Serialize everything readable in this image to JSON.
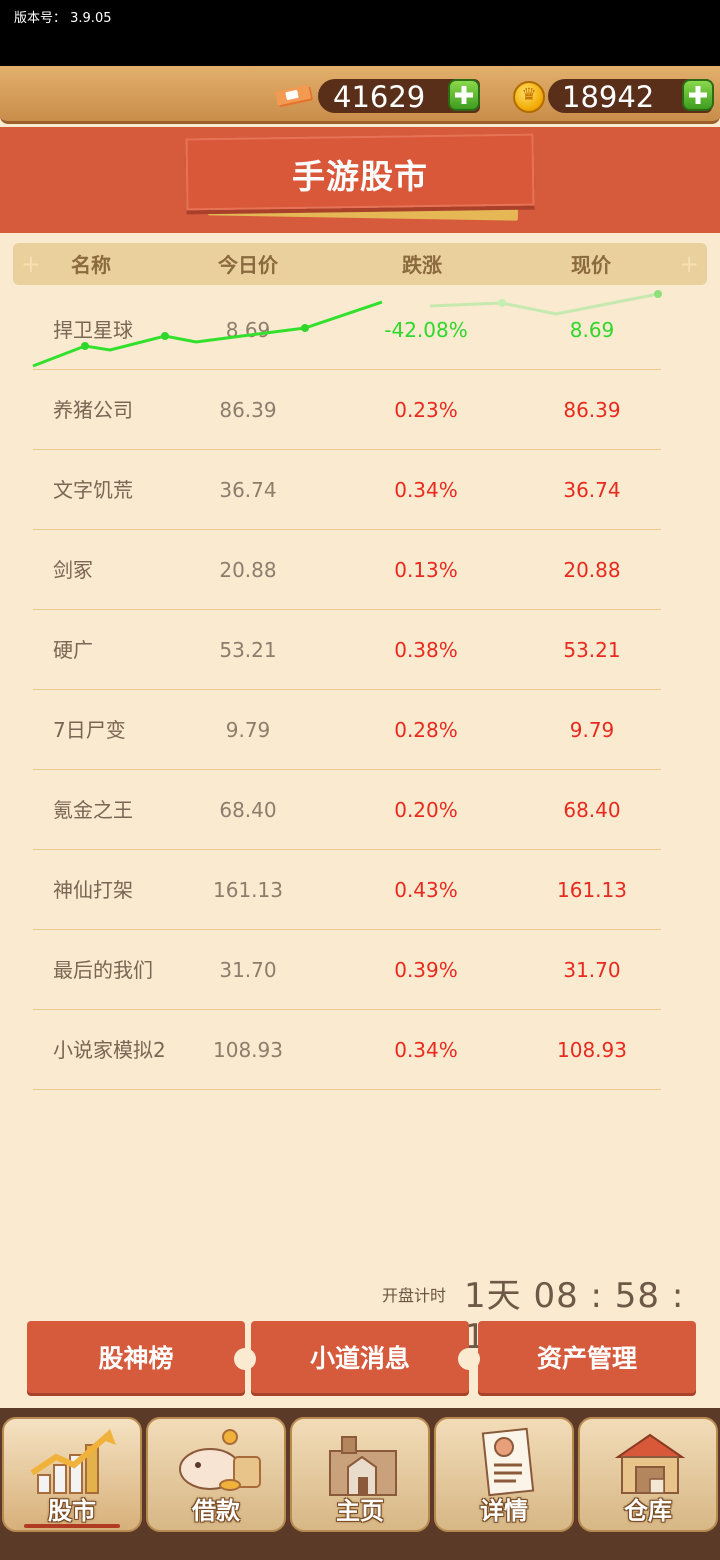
{
  "app": {
    "version_label": "版本号：  3.9.05"
  },
  "currency": {
    "cash": "41629",
    "coins": "18942"
  },
  "header": {
    "title": "手游股市"
  },
  "table": {
    "columns": [
      "名称",
      "今日价",
      "跌涨",
      "现价"
    ],
    "rows": [
      {
        "name": "捍卫星球",
        "today": "8.69",
        "change": "-42.08%",
        "current": "8.69",
        "trend": "down"
      },
      {
        "name": "养猪公司",
        "today": "86.39",
        "change": "0.23%",
        "current": "86.39",
        "trend": "up"
      },
      {
        "name": "文字饥荒",
        "today": "36.74",
        "change": "0.34%",
        "current": "36.74",
        "trend": "up"
      },
      {
        "name": "剑冢",
        "today": "20.88",
        "change": "0.13%",
        "current": "20.88",
        "trend": "up"
      },
      {
        "name": "硬广",
        "today": "53.21",
        "change": "0.38%",
        "current": "53.21",
        "trend": "up"
      },
      {
        "name": "7日尸变",
        "today": "9.79",
        "change": "0.28%",
        "current": "9.79",
        "trend": "up"
      },
      {
        "name": "氪金之王",
        "today": "68.40",
        "change": "0.20%",
        "current": "68.40",
        "trend": "up"
      },
      {
        "name": "神仙打架",
        "today": "161.13",
        "change": "0.43%",
        "current": "161.13",
        "trend": "up"
      },
      {
        "name": "最后的我们",
        "today": "31.70",
        "change": "0.39%",
        "current": "31.70",
        "trend": "up"
      },
      {
        "name": "小说家模拟2",
        "today": "108.93",
        "change": "0.34%",
        "current": "108.93",
        "trend": "up"
      }
    ]
  },
  "countdown": {
    "label": "开盘计时",
    "value": "1天 08 : 58 : 11"
  },
  "actions": {
    "leaderboard": "股神榜",
    "news": "小道消息",
    "assets": "资产管理"
  },
  "nav": {
    "tabs": [
      {
        "label": "股市",
        "icon": "stock-chart-icon",
        "active": true
      },
      {
        "label": "借款",
        "icon": "piggy-bank-icon",
        "active": false
      },
      {
        "label": "主页",
        "icon": "home-building-icon",
        "active": false
      },
      {
        "label": "详情",
        "icon": "profile-card-icon",
        "active": false
      },
      {
        "label": "仓库",
        "icon": "warehouse-icon",
        "active": false
      }
    ]
  },
  "colors": {
    "up": "#e82b1e",
    "down": "#2fd72a",
    "accent": "#d65b3d",
    "background": "#f9ead0"
  }
}
